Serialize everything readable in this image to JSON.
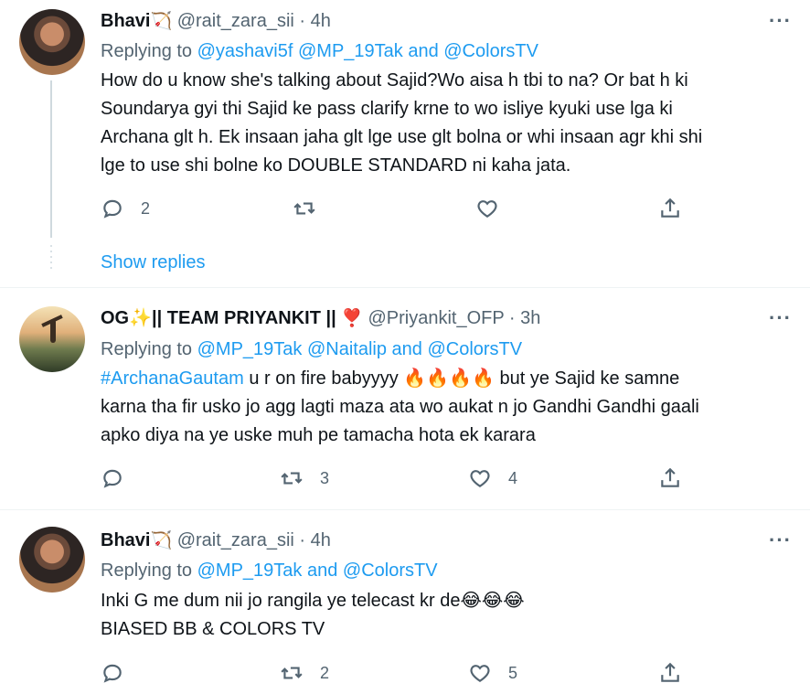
{
  "tweets": [
    {
      "name": "Bhavi",
      "emoji": "🏹",
      "handle": "@rait_zara_sii",
      "sep": "·",
      "time": "4h",
      "replying_label": "Replying to",
      "replying_targets": "@yashavi5f @MP_19Tak and @ColorsTV",
      "lines": [
        "How do u know she's talking about Sajid?Wo aisa h tbi to na? Or bat h ki",
        "Soundarya gyi thi Sajid ke pass clarify krne to wo isliye kyuki use lga ki",
        "Archana glt h. Ek insaan jaha glt lge use glt bolna or whi insaan agr khi shi",
        "lge to use shi bolne ko DOUBLE STANDARD ni kaha jata."
      ],
      "reply_count": "2",
      "retweet_count": "",
      "like_count": "",
      "show_replies": "Show replies"
    },
    {
      "name": "OG✨|| TEAM PRIYANKIT ||",
      "emoji": "❣️",
      "handle": "@Priyankit_OFP",
      "sep": "·",
      "time": "3h",
      "replying_label": "Replying to",
      "replying_targets": "@MP_19Tak @Naitalip and @ColorsTV",
      "hashtag": "#ArchanaGautam",
      "line1_rest": " u r on fire babyyyy 🔥🔥🔥🔥 but ye Sajid ke samne",
      "lines": [
        "karna tha fir usko jo agg lagti maza ata wo aukat n jo Gandhi Gandhi gaali",
        "apko diya na ye uske muh pe tamacha hota ek karara"
      ],
      "reply_count": "",
      "retweet_count": "3",
      "like_count": "4"
    },
    {
      "name": "Bhavi",
      "emoji": "🏹",
      "handle": "@rait_zara_sii",
      "sep": "·",
      "time": "4h",
      "replying_label": "Replying to",
      "replying_targets": "@MP_19Tak and @ColorsTV",
      "lines": [
        "Inki G me dum nii jo rangila ye telecast kr de😂😂😂",
        "BIASED BB & COLORS TV"
      ],
      "reply_count": "",
      "retweet_count": "2",
      "like_count": "5"
    }
  ],
  "more_icon": "···",
  "colors": {
    "link": "#1d9bf0",
    "secondary_text": "#536471",
    "primary_text": "#0f1419",
    "divider": "#eff3f4"
  },
  "icons": [
    "reply-icon",
    "retweet-icon",
    "like-icon",
    "share-icon",
    "more-icon"
  ]
}
